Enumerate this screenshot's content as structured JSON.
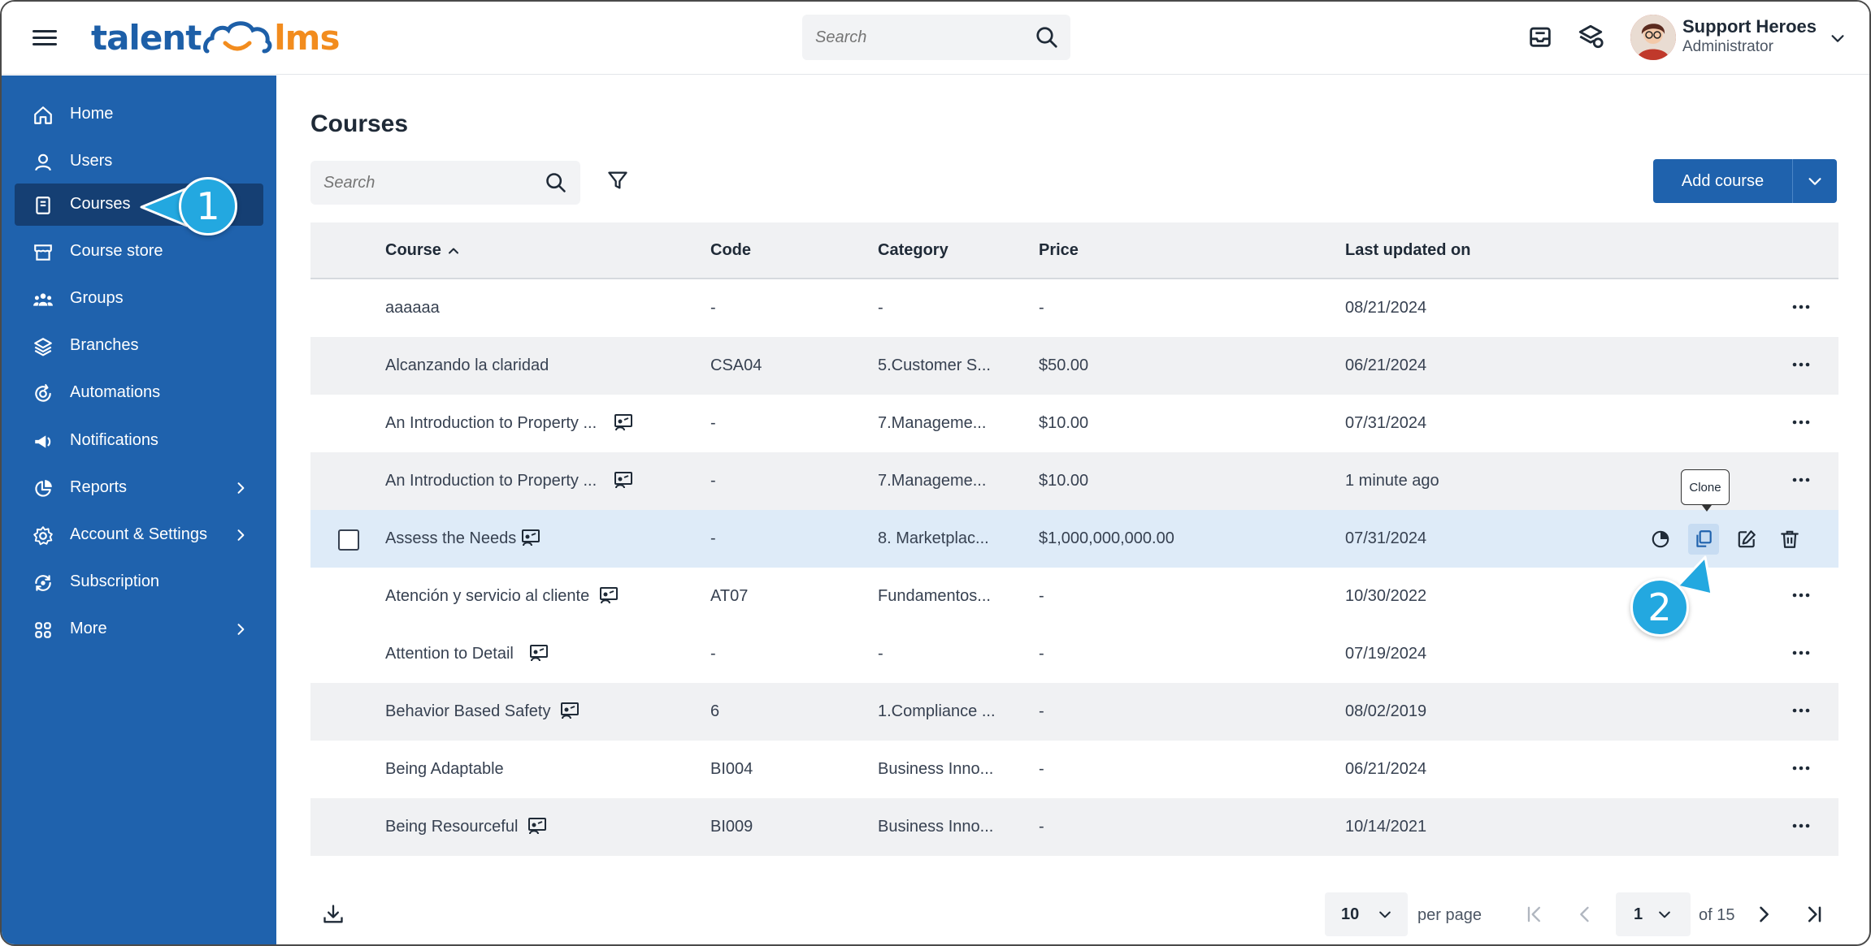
{
  "header": {
    "brand_left": "talent",
    "brand_right": "lms",
    "search_placeholder": "Search",
    "user_name": "Support Heroes",
    "user_role": "Administrator"
  },
  "sidebar": {
    "items": [
      {
        "label": "Home",
        "icon": "home-icon"
      },
      {
        "label": "Users",
        "icon": "user-icon"
      },
      {
        "label": "Courses",
        "icon": "book-icon",
        "active": true
      },
      {
        "label": "Course store",
        "icon": "store-icon"
      },
      {
        "label": "Groups",
        "icon": "groups-icon"
      },
      {
        "label": "Branches",
        "icon": "layers-icon"
      },
      {
        "label": "Automations",
        "icon": "automation-icon"
      },
      {
        "label": "Notifications",
        "icon": "megaphone-icon"
      },
      {
        "label": "Reports",
        "icon": "pie-chart-icon",
        "has_submenu": true
      },
      {
        "label": "Account & Settings",
        "icon": "gear-icon",
        "has_submenu": true
      },
      {
        "label": "Subscription",
        "icon": "subscription-icon"
      },
      {
        "label": "More",
        "icon": "grid-icon",
        "has_submenu": true
      }
    ]
  },
  "callouts": {
    "one": "1",
    "two": "2"
  },
  "main": {
    "title": "Courses",
    "search_placeholder": "Search",
    "add_course_label": "Add course",
    "tooltip_clone": "Clone"
  },
  "table": {
    "columns": {
      "course": "Course",
      "code": "Code",
      "category": "Category",
      "price": "Price",
      "updated": "Last updated on"
    },
    "rows": [
      {
        "course": "aaaaaa",
        "code": "-",
        "category": "-",
        "price": "-",
        "updated": "08/21/2024",
        "has_icon": false
      },
      {
        "course": "Alcanzando la claridad",
        "code": "CSA04",
        "category": "5.Customer S...",
        "price": "$50.00",
        "updated": "06/21/2024",
        "has_icon": false
      },
      {
        "course": "An Introduction to Property ...",
        "code": "-",
        "category": "7.Manageme...",
        "price": "$10.00",
        "updated": "07/31/2024",
        "has_icon": true
      },
      {
        "course": "An Introduction to Property ...",
        "code": "-",
        "category": "7.Manageme...",
        "price": "$10.00",
        "updated": "1 minute ago",
        "has_icon": true
      },
      {
        "course": "Assess the Needs",
        "code": "-",
        "category": "8. Marketplac...",
        "price": "$1,000,000,000.00",
        "updated": "07/31/2024",
        "has_icon": true,
        "hovered": true
      },
      {
        "course": "Atención y servicio al cliente",
        "code": "AT07",
        "category": "Fundamentos...",
        "price": "-",
        "updated": "10/30/2022",
        "has_icon": true
      },
      {
        "course": "Attention to Detail",
        "code": "-",
        "category": "-",
        "price": "-",
        "updated": "07/19/2024",
        "has_icon": true
      },
      {
        "course": "Behavior Based Safety",
        "code": "6",
        "category": "1.Compliance ...",
        "price": "-",
        "updated": "08/02/2019",
        "has_icon": true
      },
      {
        "course": "Being Adaptable",
        "code": "BI004",
        "category": "Business Inno...",
        "price": "-",
        "updated": "06/21/2024",
        "has_icon": false
      },
      {
        "course": "Being Resourceful",
        "code": "BI009",
        "category": "Business Inno...",
        "price": "-",
        "updated": "10/14/2021",
        "has_icon": true
      }
    ]
  },
  "pagination": {
    "per_page_value": "10",
    "per_page_label": "per page",
    "current_page": "1",
    "of_pages": "of 15"
  },
  "colors": {
    "sidebar": "#1f62ad",
    "sidebar_active": "#153f73",
    "brand_blue": "#1d5fa8",
    "brand_orange": "#f28c1e",
    "callout": "#23a8e0",
    "row_highlight": "#deebf8"
  }
}
